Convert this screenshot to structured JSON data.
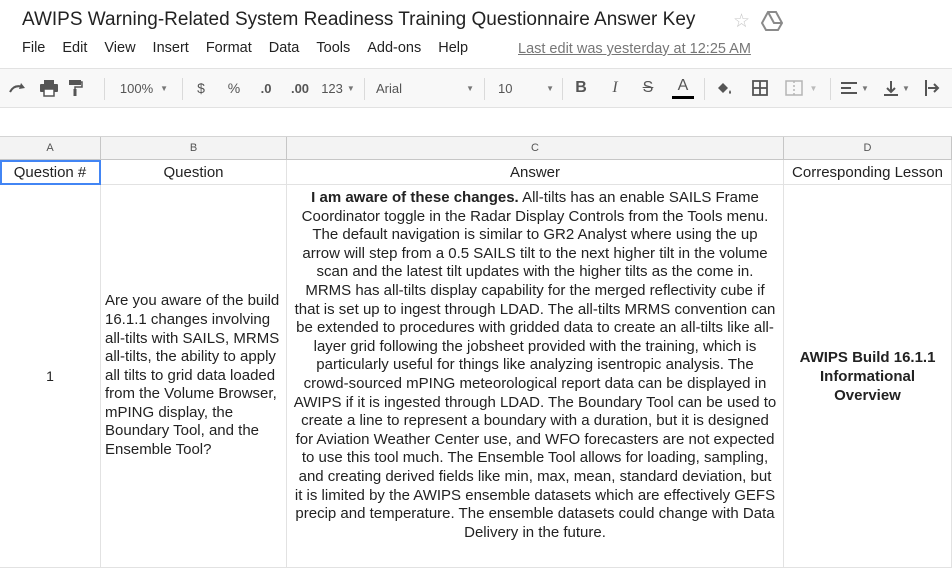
{
  "doc": {
    "title": "AWIPS Warning-Related System Readiness Training Questionnaire Answer Key",
    "star_icon": "star-icon",
    "drive_icon": "drive-icon"
  },
  "menu": {
    "items": [
      "File",
      "Edit",
      "View",
      "Insert",
      "Format",
      "Data",
      "Tools",
      "Add-ons",
      "Help"
    ],
    "last_edit": "Last edit was yesterday at 12:25 AM"
  },
  "toolbar": {
    "zoom": "100%",
    "currency": "$",
    "percent": "%",
    "dec_less": ".0",
    "dec_more": ".00",
    "more_formats": "123",
    "font": "Arial",
    "font_size": "10",
    "bold": "B",
    "italic": "I",
    "strike": "S",
    "text_color": "A"
  },
  "columns": [
    "A",
    "B",
    "C",
    "D"
  ],
  "header_row": {
    "a": "Question #",
    "b": "Question",
    "c": "Answer",
    "d": "Corresponding Lesson"
  },
  "row1": {
    "number": "1",
    "question": "Are you aware of the build 16.1.1 changes involving all-tilts with SAILS, MRMS all-tilts, the ability to apply all tilts to grid data loaded from the Volume Browser, mPING display, the Boundary Tool, and the Ensemble Tool?",
    "answer_bold": "I am aware of these changes.",
    "answer_rest": " All-tilts has an enable SAILS Frame Coordinator toggle in the Radar Display Controls from the Tools menu. The default navigation is similar to GR2 Analyst where using the up arrow will step from a 0.5 SAILS tilt to the next higher tilt in the volume scan and the latest tilt updates with the higher tilts as the come in. MRMS has all-tilts display capability for the merged reflectivity cube if that is set up to ingest through LDAD. The all-tilts MRMS convention can be extended to procedures with gridded data to create an all-tilts like all-layer grid following the jobsheet provided with the training, which is particularly useful for things like analyzing isentropic analysis. The crowd-sourced mPING meteorological report data can be displayed in AWIPS if it is ingested through LDAD. The Boundary Tool can be used to create a line to represent a boundary with a duration, but it is designed for Aviation Weather Center use, and WFO forecasters are not expected to use this tool much. The Ensemble Tool allows for loading, sampling, and creating derived fields like min, max, mean, standard deviation, but it is limited by the AWIPS ensemble datasets which are effectively GEFS precip and temperature. The ensemble datasets could change with Data Delivery in the future.",
    "lesson": "AWIPS Build 16.1.1 Informational Overview"
  },
  "colors": {
    "selection": "#4285f4",
    "header_bg": "#f3f3f3",
    "toolbar_bg": "#f8f8f8"
  }
}
